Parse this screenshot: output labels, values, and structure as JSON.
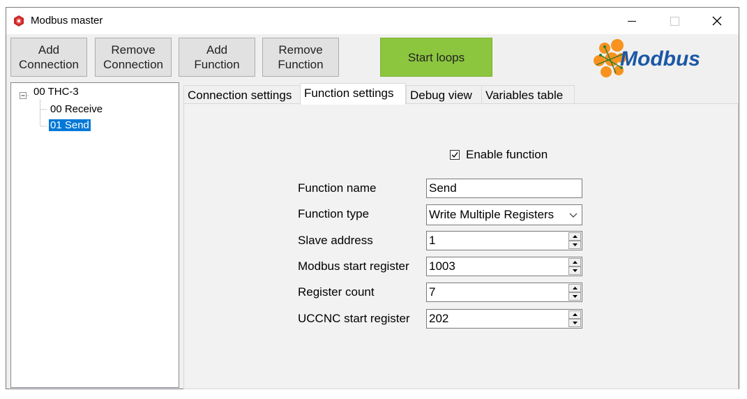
{
  "window": {
    "title": "Modbus master"
  },
  "toolbar": {
    "add_connection": [
      "Add",
      "Connection"
    ],
    "remove_connection": [
      "Remove",
      "Connection"
    ],
    "add_function": [
      "Add",
      "Function"
    ],
    "remove_function": [
      "Remove",
      "Function"
    ],
    "start_loops": "Start loops",
    "logo_text": "Modbus"
  },
  "tree": {
    "root": "00 THC-3",
    "children": [
      "00 Receive",
      "01 Send"
    ],
    "selected": "01 Send"
  },
  "tabs": [
    "Connection settings",
    "Function settings",
    "Debug view",
    "Variables table"
  ],
  "active_tab": "Function settings",
  "function_settings": {
    "enable_label": "Enable function",
    "enabled": true,
    "fields": [
      {
        "label": "Function name",
        "value": "Send",
        "kind": "text"
      },
      {
        "label": "Function type",
        "value": "Write Multiple Registers",
        "kind": "select"
      },
      {
        "label": "Slave address",
        "value": "1",
        "kind": "spin"
      },
      {
        "label": "Modbus start register",
        "value": "1003",
        "kind": "spin"
      },
      {
        "label": "Register count",
        "value": "7",
        "kind": "spin"
      },
      {
        "label": "UCCNC start register",
        "value": "202",
        "kind": "spin"
      }
    ]
  },
  "colors": {
    "accent_green": "#8cc63f",
    "selection_blue": "#0078d7",
    "logo_blue": "#1b57a6",
    "logo_orange": "#f7931e"
  }
}
